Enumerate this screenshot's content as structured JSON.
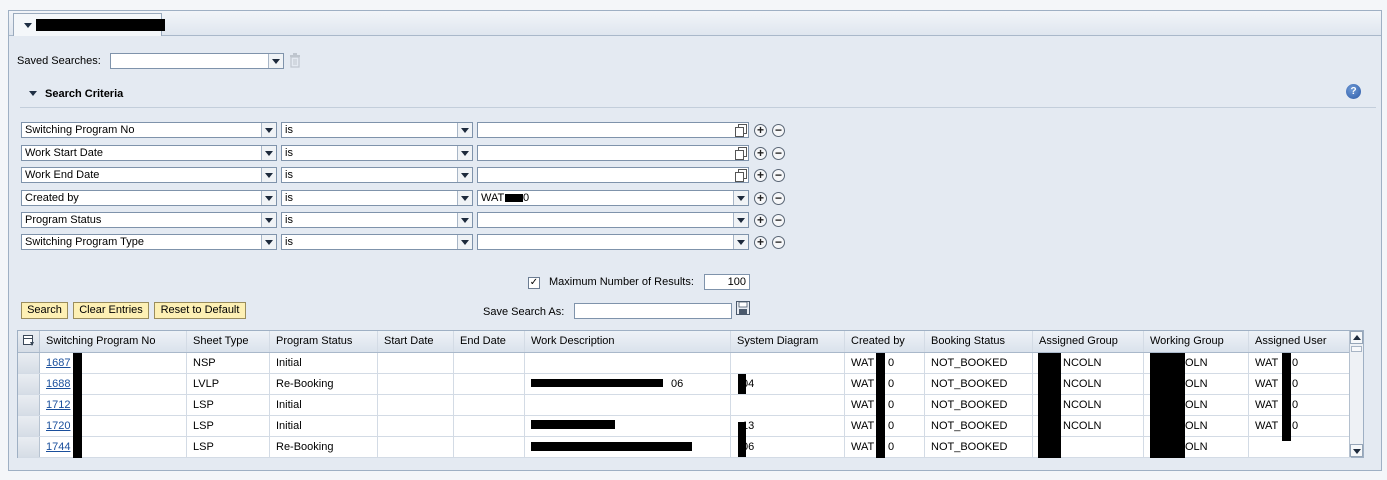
{
  "saved_searches": {
    "label": "Saved Searches:",
    "value": ""
  },
  "search_criteria": {
    "title": "Search Criteria",
    "rows": [
      {
        "field": "Switching Program No",
        "operator": "is",
        "value": "",
        "value_type": "input"
      },
      {
        "field": "Work Start Date",
        "operator": "is",
        "value": "",
        "value_type": "input"
      },
      {
        "field": "Work End Date",
        "operator": "is",
        "value": "",
        "value_type": "input"
      },
      {
        "field": "Created by",
        "operator": "is",
        "value": "WAT",
        "value_suffix": "0",
        "value_type": "select"
      },
      {
        "field": "Program Status",
        "operator": "is",
        "value": "",
        "value_type": "select"
      },
      {
        "field": "Switching Program Type",
        "operator": "is",
        "value": "",
        "value_type": "select"
      }
    ],
    "add_symbol": "+",
    "remove_symbol": "−"
  },
  "max_results": {
    "label": "Maximum Number of Results:",
    "value": "100",
    "checked": true,
    "check_mark": "✓"
  },
  "buttons": {
    "search": "Search",
    "clear": "Clear Entries",
    "reset": "Reset to Default"
  },
  "save_search": {
    "label": "Save Search As:",
    "value": ""
  },
  "help": {
    "symbol": "?"
  },
  "table": {
    "columns": [
      "Switching Program No",
      "Sheet Type",
      "Program Status",
      "Start Date",
      "End Date",
      "Work Description",
      "System Diagram",
      "Created by",
      "Booking Status",
      "Assigned Group",
      "Working Group",
      "Assigned User"
    ],
    "rows": [
      {
        "program_no": "1687",
        "sheet_type": "NSP",
        "status": "Initial",
        "start": "",
        "end": "",
        "description": "",
        "diagram": "",
        "created_by": "WAT",
        "created_suffix": "0",
        "booking": "NOT_BOOKED",
        "assigned_group": "NCOLN",
        "working_group": "COLN",
        "assigned_user": "WAT",
        "assigned_user_suffix": "0"
      },
      {
        "program_no": "1688",
        "sheet_type": "LVLP",
        "status": "Re-Booking",
        "start": "",
        "end": "",
        "description": "06",
        "diagram": "04",
        "created_by": "WAT",
        "created_suffix": "0",
        "booking": "NOT_BOOKED",
        "assigned_group": "NCOLN",
        "working_group": "COLN",
        "assigned_user": "WAT",
        "assigned_user_suffix": "0"
      },
      {
        "program_no": "1712",
        "sheet_type": "LSP",
        "status": "Initial",
        "start": "",
        "end": "",
        "description": "",
        "diagram": "",
        "created_by": "WAT",
        "created_suffix": "0",
        "booking": "NOT_BOOKED",
        "assigned_group": "NCOLN",
        "working_group": "COLN",
        "assigned_user": "WAT",
        "assigned_user_suffix": "0"
      },
      {
        "program_no": "1720",
        "sheet_type": "LSP",
        "status": "Initial",
        "start": "",
        "end": "",
        "description": "",
        "diagram": "13",
        "created_by": "WAT",
        "created_suffix": "0",
        "booking": "NOT_BOOKED",
        "assigned_group": "NCOLN",
        "working_group": "COLN",
        "assigned_user": "WAT",
        "assigned_user_suffix": "0"
      },
      {
        "program_no": "1744",
        "sheet_type": "LSP",
        "status": "Re-Booking",
        "start": "",
        "end": "",
        "description": "",
        "diagram": "06",
        "created_by": "WAT",
        "created_suffix": "0",
        "booking": "NOT_BOOKED",
        "assigned_group": "",
        "working_group": "COLN",
        "assigned_user": "",
        "assigned_user_suffix": ""
      }
    ]
  }
}
